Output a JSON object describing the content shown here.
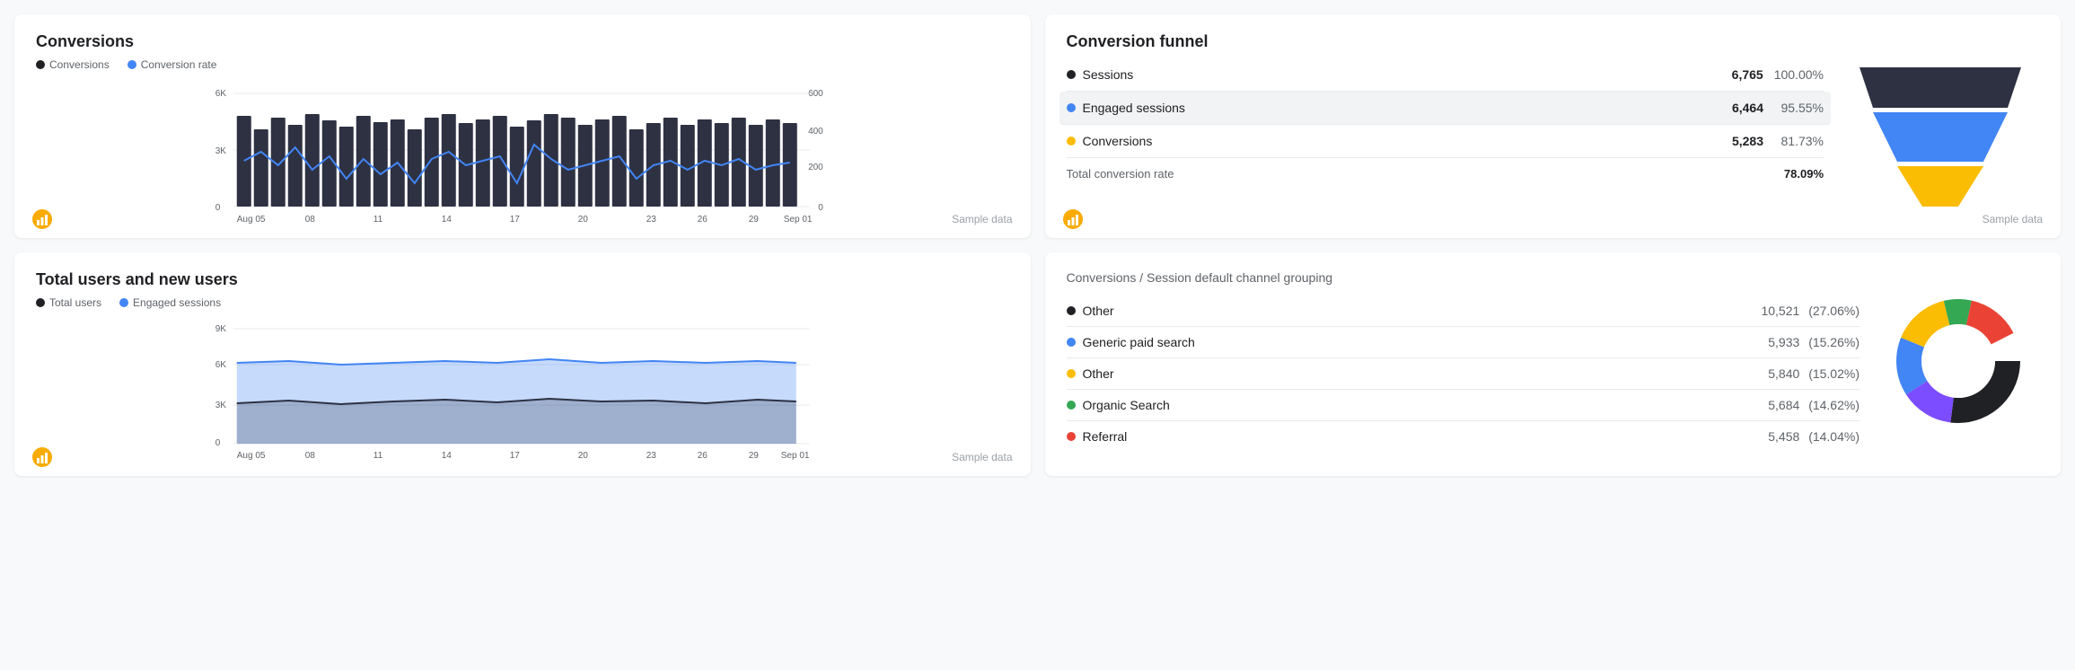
{
  "conversions": {
    "title": "Conversions",
    "legend": [
      {
        "label": "Conversions",
        "color": "#202124"
      },
      {
        "label": "Conversion rate",
        "color": "#4285f4"
      }
    ],
    "yAxisLeft": [
      "6K",
      "3K",
      "0"
    ],
    "yAxisRight": [
      "600",
      "400",
      "200",
      "0"
    ],
    "xLabels": [
      "Aug 05",
      "08",
      "11",
      "14",
      "17",
      "20",
      "23",
      "26",
      "29",
      "Sep 01"
    ],
    "sampleData": "Sample data"
  },
  "conversionFunnel": {
    "title": "Conversion funnel",
    "rows": [
      {
        "label": "Sessions",
        "dot": "#202124",
        "value": "6,765",
        "pct": "100.00%",
        "highlighted": false
      },
      {
        "label": "Engaged sessions",
        "dot": "#4285f4",
        "value": "6,464",
        "pct": "95.55%",
        "highlighted": true
      },
      {
        "label": "Conversions",
        "dot": "#fbbc04",
        "value": "5,283",
        "pct": "81.73%",
        "highlighted": false
      }
    ],
    "totalLabel": "Total conversion rate",
    "totalValue": "78.09%",
    "sampleData": "Sample data"
  },
  "totalUsers": {
    "title": "Total users and new users",
    "legend": [
      {
        "label": "Total users",
        "color": "#202124"
      },
      {
        "label": "Engaged sessions",
        "color": "#4285f4"
      }
    ],
    "yAxis": [
      "9K",
      "6K",
      "3K",
      "0"
    ],
    "xLabels": [
      "Aug 05",
      "08",
      "11",
      "14",
      "17",
      "20",
      "23",
      "26",
      "29",
      "Sep 01"
    ],
    "sampleData": "Sample data"
  },
  "channelGrouping": {
    "subtitle": "Conversions / Session default channel grouping",
    "rows": [
      {
        "label": "Other",
        "dot": "#202124",
        "value": "10,521",
        "pct": "(27.06%)"
      },
      {
        "label": "Generic paid search",
        "dot": "#4285f4",
        "value": "5,933",
        "pct": "(15.26%)"
      },
      {
        "label": "Other",
        "dot": "#fbbc04",
        "value": "5,840",
        "pct": "(15.02%)"
      },
      {
        "label": "Organic Search",
        "dot": "#34a853",
        "value": "5,684",
        "pct": "(14.62%)"
      },
      {
        "label": "Referral",
        "dot": "#ea4335",
        "value": "5,458",
        "pct": "(14.04%)"
      }
    ]
  }
}
